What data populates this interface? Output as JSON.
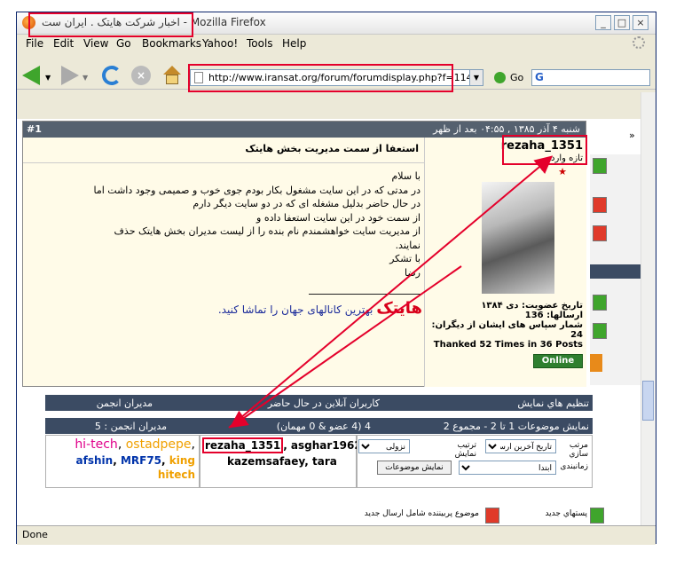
{
  "window": {
    "title": "اخبار شرکت هایتک . ایران ست - Mozilla Firefox"
  },
  "menu": [
    "File",
    "Edit",
    "View",
    "Go",
    "Bookmarks",
    "Yahoo!",
    "Tools",
    "Help"
  ],
  "nav": {
    "url": "http://www.iransat.org/forum/forumdisplay.php?f=114",
    "go_label": "Go"
  },
  "popup": {
    "post_number": "#1",
    "date": "شنبه ۴ آذر ۱۳۸۵ , ۰۴:۵۵ بعد از ظهر",
    "subject": "استعفا از سمت مدیریت بخش هایتک",
    "body_lines": [
      "با سلام",
      "در مدتی که در این سایت مشغول بکار بودم جوی خوب و صمیمی وجود داشت اما",
      "در حال حاضر بدلیل مشغله ای که در دو سایت دیگر دارم",
      "از سمت خود در این سایت استعفا داده و",
      "از مدیریت سایت خواهشمندم نام بنده را از لیست مدیران بخش هایتک حذف",
      "نمایند.",
      "با تشکر",
      "رضا"
    ],
    "signature": {
      "brand": "هایتک",
      "text": "بهترین کانالهای جهان را تماشا کنید."
    }
  },
  "user": {
    "name": "rezaha_1351",
    "rank": "تازه وارد",
    "join_date": "تاریخ عضویت: دی ۱۳۸۴",
    "posts": "ارسالها: 136",
    "thanks_given": "شمار سپاس های ایشان از دیگران: 24",
    "thanks_received": "Thanked 52 Times in 36 Posts",
    "status": "Online"
  },
  "forum": {
    "display_options": "تنظیم هاي نمایش",
    "online_users": "کاربران آنلاین در حال حاضر",
    "moderators": "مدیران انجمن",
    "showing": "نمایش موضوعات 1 تا 2 - مجموع 2",
    "online_count": "4 (4 عضو & 0 مهمان)",
    "moderator_count": "مدیران انجمن : 5",
    "online_names_1": "rezaha_1351",
    "online_names_2": ", asghar1962,",
    "online_names_3": "kazemsafaey, tara",
    "mods": {
      "m1": "hi-tech",
      "m2": "ostadpepe",
      "m3": "afshin",
      "m4": "MRF75",
      "m5": "king",
      "m6": "hitech"
    },
    "sort_label": "مرتب سازي",
    "order_label": "ترتیب نمایش",
    "time_label": "زمانبندی",
    "sort_value": "تاریخ آخرین ارسال",
    "order_value": "نزولی",
    "time_value": "ابتدا",
    "show_button": "نمایش موضوعات",
    "legend_new": "پستهاي جدید",
    "legend_hot": "موضوع پربیننده شامل ارسال جدید"
  },
  "status": "Done"
}
